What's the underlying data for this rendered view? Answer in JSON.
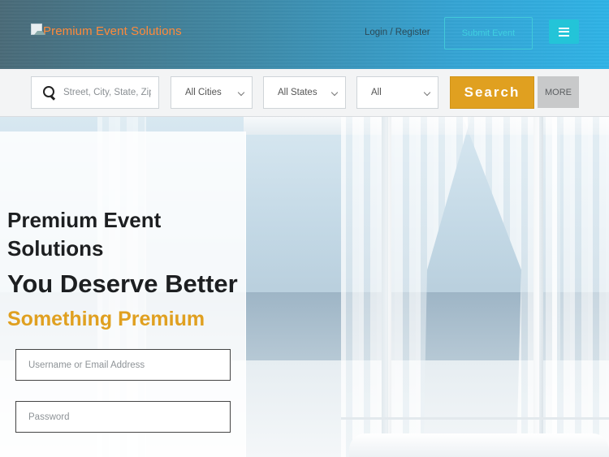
{
  "header": {
    "logo_text": "Premium Event Solutions",
    "login_label": "Login",
    "login_separator": " / ",
    "register_label": "Register",
    "post_event_label": "Submit Event"
  },
  "search": {
    "placeholder": "Street, City, State, Zip",
    "cities_selected": "All Cities",
    "states_selected": "All States",
    "category_selected": "All",
    "search_label": "Search",
    "more_label": "MORE"
  },
  "hero": {
    "title": "Premium Event Solutions",
    "tagline": "You Deserve Better",
    "subtagline": "Something Premium"
  },
  "login_form": {
    "username_placeholder": "Username or Email Address",
    "password_placeholder": "Password"
  },
  "colors": {
    "accent": "#e0a020",
    "cyan": "#23c4d8",
    "logo": "#ff8a3a"
  }
}
